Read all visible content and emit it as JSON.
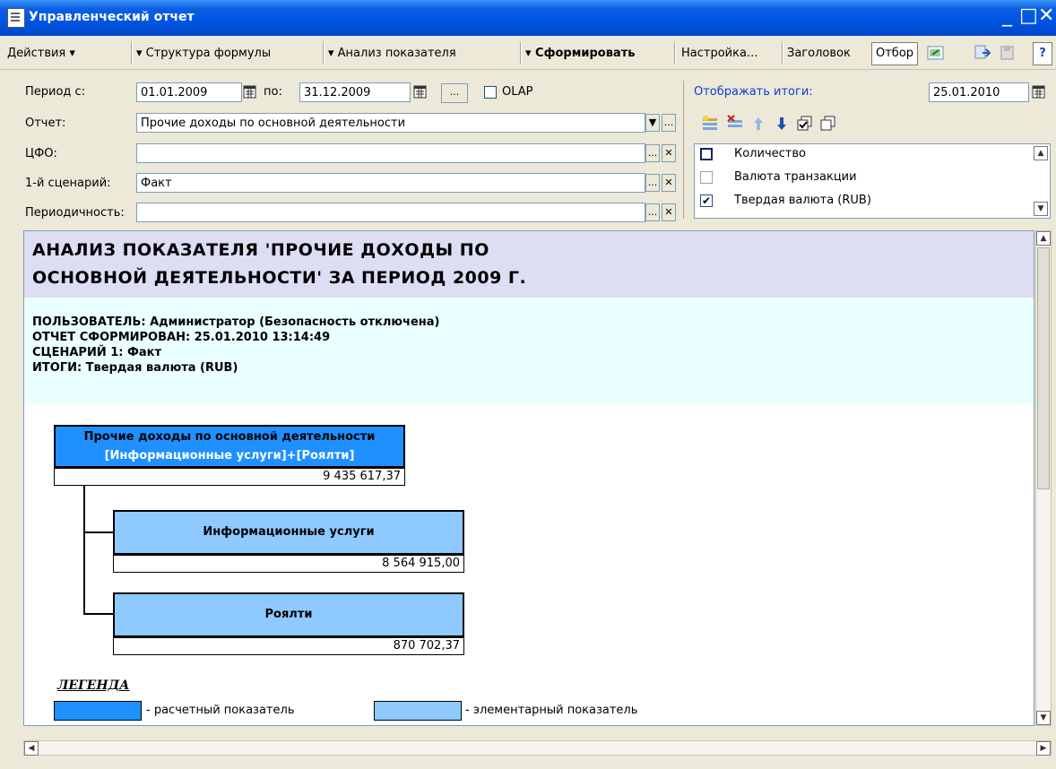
{
  "window": {
    "title": "Управленческий отчет",
    "minimize": "_",
    "maximize": "□",
    "close": "✕"
  },
  "toolbar": {
    "actions": "Действия ▾",
    "formula_structure": "▾ Структура формулы",
    "indicator_analysis": "▾ Анализ показателя",
    "generate": "▾ Сформировать",
    "settings": "Настройка...",
    "header": "Заголовок",
    "filter": "Отбор",
    "help": "?"
  },
  "params": {
    "period_from_label": "Период с:",
    "period_from": "01.01.2009",
    "to_label": "по:",
    "period_to": "31.12.2009",
    "ellipsis": "...",
    "olap_label": "OLAP",
    "olap_checked": false,
    "report_label": "Отчет:",
    "report_value": "Прочие доходы по основной деятельности",
    "cfo_label": "ЦФО:",
    "cfo_value": "",
    "scenario_label": "1-й сценарий:",
    "scenario_value": "Факт",
    "periodicity_label": "Периодичность:",
    "periodicity_value": ""
  },
  "totals": {
    "label": "Отображать итоги:",
    "date": "25.01.2010",
    "items": [
      {
        "label": "Количество",
        "checked": false
      },
      {
        "label": "Валюта транзакции",
        "checked": false
      },
      {
        "label": "Твердая валюта (RUB)",
        "checked": true
      }
    ]
  },
  "report": {
    "title_line1": "АНАЛИЗ ПОКАЗАТЕЛЯ 'ПРОЧИЕ ДОХОДЫ ПО",
    "title_line2": "ОСНОВНОЙ ДЕЯТЕЛЬНОСТИ' ЗА ПЕРИОД 2009 Г.",
    "user": "ПОЛЬЗОВАТЕЛЬ: Администратор (Безопасность отключена)",
    "generated": "ОТЧЕТ СФОРМИРОВАН: 25.01.2010 13:14:49",
    "scenario": "СЦЕНАРИЙ 1: Факт",
    "totals": "ИТОГИ: Твердая валюта (RUB)",
    "root": {
      "name": "Прочие доходы по основной деятельности",
      "formula": "[Информационные услуги]+[Роялти]",
      "value": "9 435 617,37"
    },
    "children": [
      {
        "name": "Информационные услуги",
        "value": "8 564 915,00"
      },
      {
        "name": "Роялти",
        "value": "870 702,37"
      }
    ],
    "legend_title": "ЛЕГЕНДА",
    "legend_calc": "- расчетный показатель",
    "legend_elem": "- элементарный показатель"
  },
  "colors": {
    "calc": "#1e90ff",
    "elem": "#8ec9ff",
    "title_bg": "#ddddf4",
    "info_bg": "#eaffff"
  }
}
